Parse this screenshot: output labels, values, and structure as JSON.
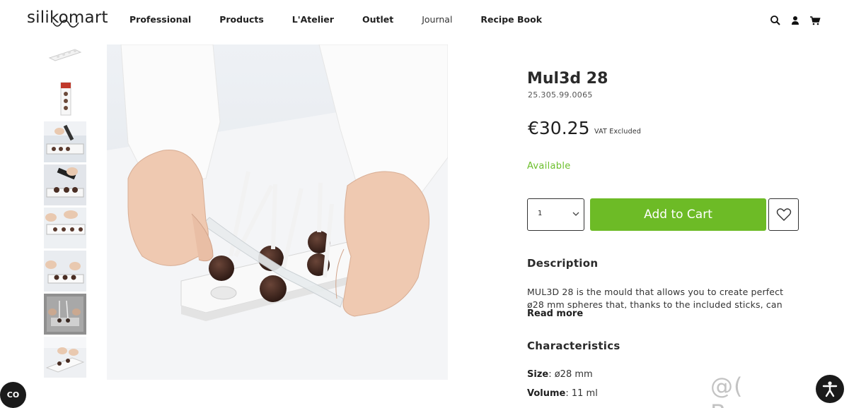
{
  "header": {
    "logo_text": "silikomart",
    "nav": [
      {
        "label": "Professional",
        "bold": true
      },
      {
        "label": "Products",
        "bold": true
      },
      {
        "label": "L'Atelier",
        "bold": true
      },
      {
        "label": "Outlet",
        "bold": true
      },
      {
        "label": "Journal",
        "bold": false
      },
      {
        "label": "Recipe Book",
        "bold": true
      }
    ],
    "icons": [
      "search-icon",
      "user-icon",
      "cart-icon"
    ]
  },
  "gallery": {
    "thumbnails": [
      "thumbnail-1",
      "thumbnail-2",
      "thumbnail-3",
      "thumbnail-4",
      "thumbnail-5",
      "thumbnail-6",
      "thumbnail-7",
      "thumbnail-8"
    ]
  },
  "product": {
    "title": "Mul3d 28",
    "sku": "25.305.99.0065",
    "price": "€30.25",
    "vat_note": "VAT Excluded",
    "availability": "Available",
    "quantity": "1",
    "add_to_cart": "Add to Cart",
    "description_heading": "Description",
    "description_text": "MUL3D 28 is the mould that allows you to create perfect ø28 mm spheres that, thanks to the included sticks, can",
    "read_more": "Read more",
    "characteristics_heading": "Characteristics",
    "characteristics": [
      {
        "label": "Size",
        "value": ": ø28 mm"
      },
      {
        "label": "Volume",
        "value": ": 11 ml"
      }
    ]
  },
  "overlays": {
    "consent_button": "CO",
    "watermark": "@( Bazos.cz"
  },
  "colors": {
    "accent_green": "#6dbb26",
    "available_green": "#6cbf2c"
  }
}
